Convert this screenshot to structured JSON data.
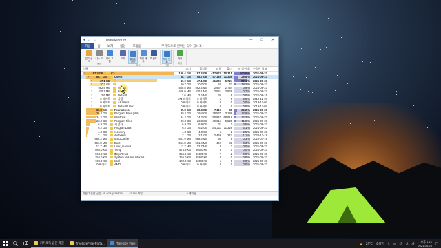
{
  "app": {
    "title": "TreeSize Free",
    "window_controls": [
      "—",
      "□",
      "✕"
    ]
  },
  "menu": {
    "items": [
      "파일",
      "홈",
      "보기",
      "옵션",
      "도움말"
    ],
    "hint": "추가적으로 원하는 것이 있나요?"
  },
  "ribbon": {
    "groups": [
      {
        "label": "동작",
        "buttons": [
          {
            "label": "업로 선택",
            "icon": "folder-select-icon",
            "color": "#e8a33a"
          },
          {
            "label": "디스 드",
            "icon": "disk-icon",
            "color": "#8a8a8a"
          },
          {
            "label": "새로 고침",
            "icon": "refresh-icon",
            "color": "#3a8ad8"
          }
        ]
      },
      {
        "label": "모드",
        "buttons": [
          {
            "label": "크기",
            "icon": "size-icon",
            "color": "#5a6aa8"
          },
          {
            "label": "할당된 공간",
            "icon": "allocated-icon",
            "color": "#4a7ac8",
            "selected": true
          },
          {
            "label": "파일 개수",
            "icon": "file-count-icon",
            "color": "#5a8ad0"
          },
          {
            "label": "퍼센트",
            "icon": "percent-icon",
            "color": "#3a5a98"
          }
        ]
      },
      {
        "label": "단위",
        "buttons": [
          {
            "label": "자동 단위",
            "icon": "auto-unit-icon",
            "color": "#3a7ac8",
            "selected": true
          }
        ]
      },
      {
        "label": "확장",
        "buttons": [
          {
            "label": "확장",
            "icon": "expand-icon",
            "color": "#4aa84a"
          }
        ]
      }
    ]
  },
  "columns": [
    "이름",
    "크기",
    "할당됨",
    "파일",
    "폴더",
    "% 상위 폴",
    "수정한 날짜"
  ],
  "rows": [
    {
      "indent": 0,
      "exp": "∨",
      "size_label": "197.3 GB",
      "name": "C:\\",
      "size": "190.4 GB",
      "alloc": "197.3 GB",
      "files": "417,670",
      "folders": "110,315",
      "pct": "100.0 %",
      "pct_val": 100,
      "date": "2021-06-23",
      "bar": 100,
      "barcolor": "#f0a830",
      "bold": true
    },
    {
      "indent": 1,
      "exp": "∨",
      "size_label": "58.7 GB",
      "name": "Users",
      "size": "58.7 GB",
      "alloc": "58.7 GB",
      "files": "47,188",
      "folders": "11,336",
      "pct": "29.8 %",
      "pct_val": 29.8,
      "date": "2021-06-23",
      "bar": 30,
      "barcolor": "#f0b040",
      "bold": true,
      "selected": true
    },
    {
      "indent": 2,
      "exp": "›",
      "size_label": "47.1 GB",
      "name": "",
      "size": "47.0 GB",
      "alloc": "47.1 GB",
      "files": "41,236",
      "folders": "5,724",
      "pct": "80.1 %",
      "pct_val": 80.1,
      "date": "2021-06-23",
      "bar": 80,
      "barcolor": "#f5c860",
      "bold": true
    },
    {
      "indent": 2,
      "exp": "›",
      "size_label": "10.7 GB",
      "name": "",
      "size": "10.7 GB",
      "alloc": "10.7 GB",
      "files": "42",
      "folders": "22",
      "pct": "18.2 %",
      "pct_val": 18.2,
      "date": "2021-06-23",
      "bar": 18,
      "barcolor": "#f8dc90"
    },
    {
      "indent": 2,
      "exp": "›",
      "size_label": "562.4 MB",
      "name": "somya",
      "size": "559.8 MB",
      "alloc": "562.4 MB",
      "files": "2,967",
      "folders": "2,754",
      "pct": "0.9 %",
      "pct_val": 0.9,
      "date": "2021-06-23",
      "bar": 1,
      "barcolor": "#f8dc90"
    },
    {
      "indent": 2,
      "exp": "›",
      "size_label": "420.1 MB",
      "name": "koojin",
      "size": "428.0 MB",
      "alloc": "430.1 MB",
      "files": "2,941",
      "folders": "2,829",
      "pct": "0.7 %",
      "pct_val": 0.7,
      "date": "2021-06-23",
      "bar": 1,
      "barcolor": "#f8dc90"
    },
    {
      "indent": 2,
      "exp": "›",
      "size_label": "2.6 MB",
      "name": "Default",
      "size": "2.6 MB",
      "alloc": "2.6 MB",
      "files": "35",
      "folders": "9",
      "pct": "0.0 %",
      "pct_val": 0,
      "date": "2021-06-19",
      "bar": 0,
      "barcolor": "#f8dc90"
    },
    {
      "indent": 2,
      "exp": "›",
      "size_label": "0 바이트",
      "name": "공용",
      "size": "174 바이트",
      "alloc": "0 바이트",
      "files": "1",
      "folders": "0",
      "pct": "0.0 %",
      "pct_val": 0,
      "date": "2019-12-07",
      "bar": 0,
      "barcolor": "#f8dc90"
    },
    {
      "indent": 2,
      "exp": "›",
      "size_label": "0 바이트",
      "name": "All Users",
      "size": "0 바이트",
      "alloc": "0 바이트",
      "files": "0",
      "folders": "0",
      "pct": "0.0 %",
      "pct_val": 0,
      "date": "2019-12-07",
      "bar": 0,
      "barcolor": "#f8dc90"
    },
    {
      "indent": 2,
      "exp": "›",
      "size_label": "0 바이트",
      "name": "Default User",
      "size": "0 바이트",
      "alloc": "0 바이트",
      "files": "0",
      "folders": "0",
      "pct": "0.0 %",
      "pct_val": 0,
      "date": "2019-12-07",
      "bar": 0,
      "barcolor": "#f8dc90"
    },
    {
      "indent": 1,
      "exp": "›",
      "size_label": "39.8 GB",
      "name": "Pearlabyss",
      "size": "39.8 GB",
      "alloc": "39.8 GB",
      "files": "7,110",
      "folders": "31",
      "pct": "20.2 %",
      "pct_val": 20.2,
      "date": "2021-06-23",
      "bar": 20,
      "barcolor": "#f0b040",
      "bold": true
    },
    {
      "indent": 1,
      "exp": "›",
      "size_label": "29.4 GB",
      "name": "Program Files (x86)",
      "size": "29.4 GB",
      "alloc": "29.4 GB",
      "files": "38,537",
      "folders": "3,198",
      "pct": "14.9 %",
      "pct_val": 14.9,
      "date": "2021-06-23",
      "bar": 15,
      "barcolor": "#f0b040"
    },
    {
      "indent": 1,
      "exp": "›",
      "size_label": "24.2 GB",
      "name": "Windows",
      "size": "24.2 GB",
      "alloc": "24.2 GB",
      "files": "150,847",
      "folders": "68,816",
      "pct": "12.3 %",
      "pct_val": 12.3,
      "date": "2021-06-23",
      "bar": 12,
      "barcolor": "#f0b040"
    },
    {
      "indent": 1,
      "exp": "›",
      "size_label": "23.3 GB",
      "name": "Program Files",
      "size": "23.3 GB",
      "alloc": "23.3 GB",
      "files": "49,615",
      "folders": "5,525",
      "pct": "11.8 %",
      "pct_val": 11.8,
      "date": "2021-06-23",
      "bar": 12,
      "barcolor": "#f0b040"
    },
    {
      "indent": 1,
      "exp": "›",
      "size_label": "6.9 GB",
      "name": "새 폴더",
      "size": "6.9 GB",
      "alloc": "6.9 GB",
      "files": "31",
      "folders": "1",
      "pct": "3.5 %",
      "pct_val": 3.5,
      "date": "2021-06-23",
      "bar": 4,
      "barcolor": "#f0b040"
    },
    {
      "indent": 1,
      "exp": "›",
      "size_label": "6.2 GB",
      "name": "ProgramData",
      "size": "6.2 GB",
      "alloc": "6.2 GB",
      "files": "102,111",
      "folders": "11,326",
      "pct": "3.1 %",
      "pct_val": 3.1,
      "date": "2021-06-23",
      "bar": 3,
      "barcolor": "#f0b040"
    },
    {
      "indent": 1,
      "exp": "›",
      "size_label": "4.8 GB",
      "name": "recovery",
      "size": "4.8 GB",
      "alloc": "4.8 GB",
      "files": "6",
      "folders": "2",
      "pct": "2.5 %",
      "pct_val": 2.5,
      "date": "2021-06-23",
      "bar": 2,
      "barcolor": "#f0b040"
    },
    {
      "indent": 1,
      "exp": "›",
      "size_label": "2.1 GB",
      "name": "Autodesk",
      "size": "2.1 GB",
      "alloc": "2.1 GB",
      "files": "2,469",
      "folders": "247",
      "pct": "1.1 %",
      "pct_val": 1.1,
      "date": "2020-12-19",
      "bar": 1,
      "barcolor": "#f0b040"
    },
    {
      "indent": 1,
      "exp": "›",
      "size_label": "668.3 MB",
      "name": "MSOCache",
      "size": "667.9 MB",
      "alloc": "668.3 MB",
      "files": "60",
      "folders": "8",
      "pct": "0.3 %",
      "pct_val": 0.3,
      "date": "2020-07-19",
      "bar": 0,
      "barcolor": "#f0b040"
    },
    {
      "indent": 1,
      "exp": "›",
      "size_label": "561.8 MB",
      "name": "Boot",
      "size": "561.8 MB",
      "alloc": "561.8 MB",
      "files": "469",
      "folders": "41",
      "pct": "0.3 %",
      "pct_val": 0.3,
      "date": "2021-06-23",
      "bar": 0,
      "barcolor": "#f0b040"
    },
    {
      "indent": 1,
      "exp": "›",
      "size_label": "12.7 MB",
      "name": "User_manual",
      "size": "12.7 MB",
      "alloc": "12.7 MB",
      "files": "3",
      "folders": "2",
      "pct": "0.0 %",
      "pct_val": 0,
      "date": "2021-06-23",
      "bar": 0,
      "barcolor": "#f0b040"
    },
    {
      "indent": 1,
      "exp": "›",
      "size_label": "980.0 KB",
      "name": "Temp",
      "size": "974.9 KB",
      "alloc": "980.0 KB",
      "files": "3",
      "folders": "0",
      "pct": "0.0 %",
      "pct_val": 0,
      "date": "2021-06-23",
      "bar": 0,
      "barcolor": "#f0b040"
    },
    {
      "indent": 1,
      "exp": "›",
      "size_label": "960.0 KB",
      "name": "$SysReset",
      "size": "956.6 KB",
      "alloc": "960.0 KB",
      "files": "7",
      "folders": "2",
      "pct": "0.0 %",
      "pct_val": 0,
      "date": "2021-06-23",
      "bar": 0,
      "barcolor": "#f0b040"
    },
    {
      "indent": 1,
      "exp": "›",
      "size_label": "256.0 KB",
      "name": "System Volume Informa...",
      "size": "256.0 KB",
      "alloc": "256.0 KB",
      "files": "0",
      "folders": "0",
      "pct": "0.0 %",
      "pct_val": 0,
      "date": "2021-06-23",
      "bar": 0,
      "barcolor": "#f0b040"
    },
    {
      "indent": 1,
      "exp": "›",
      "size_label": "100.0 KB",
      "name": "Intel",
      "size": "100.0 KB",
      "alloc": "100.0 KB",
      "files": "1",
      "folders": "1",
      "pct": "0.0 %",
      "pct_val": 0,
      "date": "2021-06-23",
      "bar": 0,
      "barcolor": "#f0b040"
    },
    {
      "indent": 1,
      "exp": "›",
      "size_label": "0 바이트",
      "name": "AMD",
      "size": "0 바이트",
      "alloc": "0 바이트",
      "files": "0",
      "folders": "0",
      "pct": "0.0 %",
      "pct_val": 0,
      "date": "2021-06-23",
      "bar": 0,
      "barcolor": "#f0b040"
    }
  ],
  "status": {
    "left": "사용 가능한 공간: 25.4GB (/ 238GB)",
    "files": "47,188 파일",
    "mid": "0 제외됨"
  },
  "taskbar": {
    "apps": [
      {
        "label": "카카오톡 받은 파일",
        "icon": "folder-icon",
        "color": "#f1c84f"
      },
      {
        "label": "TreeSizeFree-Porta...",
        "icon": "folder-icon",
        "color": "#f1c84f"
      },
      {
        "label": "TreeSize Free",
        "icon": "treesize-icon",
        "color": "#3a8ad8",
        "active": true
      }
    ],
    "weather": "24°C",
    "weather_desc": "소나기",
    "lang": "A",
    "ime": "가",
    "time": "오후 5:29",
    "date": "2021-06-23"
  }
}
